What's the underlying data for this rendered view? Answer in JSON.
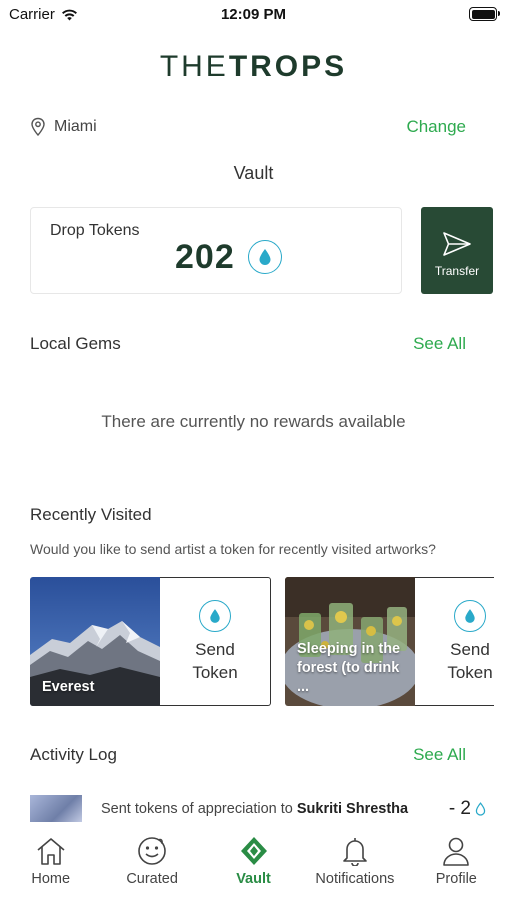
{
  "status_bar": {
    "carrier": "Carrier",
    "time": "12:09 PM"
  },
  "brand": {
    "logo_light": "THE",
    "logo_bold": "TROPS"
  },
  "location": {
    "city": "Miami",
    "change_label": "Change"
  },
  "vault": {
    "title": "Vault",
    "tokens_label": "Drop Tokens",
    "tokens_count": "202",
    "transfer_label": "Transfer"
  },
  "local_gems": {
    "title": "Local Gems",
    "see_all": "See All",
    "empty_message": "There are currently no rewards available"
  },
  "recently_visited": {
    "title": "Recently Visited",
    "subtitle": "Would you like to send artist a token for recently visited artworks?",
    "items": [
      {
        "caption": "Everest",
        "send_label": "Send\nToken"
      },
      {
        "caption": "Sleeping in the\nforest (to drink ...",
        "send_label": "Send\nToken"
      }
    ]
  },
  "activity_log": {
    "title": "Activity Log",
    "see_all": "See All",
    "entries": [
      {
        "text_prefix": "Sent tokens of appreciation to ",
        "name": "Sukriti Shrestha",
        "amount": "- 2"
      }
    ]
  },
  "tabbar": {
    "active": "vault",
    "items": [
      {
        "label": "Home"
      },
      {
        "label": "Curated"
      },
      {
        "label": "Vault"
      },
      {
        "label": "Notifications"
      },
      {
        "label": "Profile"
      }
    ]
  },
  "colors": {
    "accent_green": "#2eaa4f",
    "brand_dark_green": "#284a35",
    "drop_blue": "#29a9c9"
  }
}
